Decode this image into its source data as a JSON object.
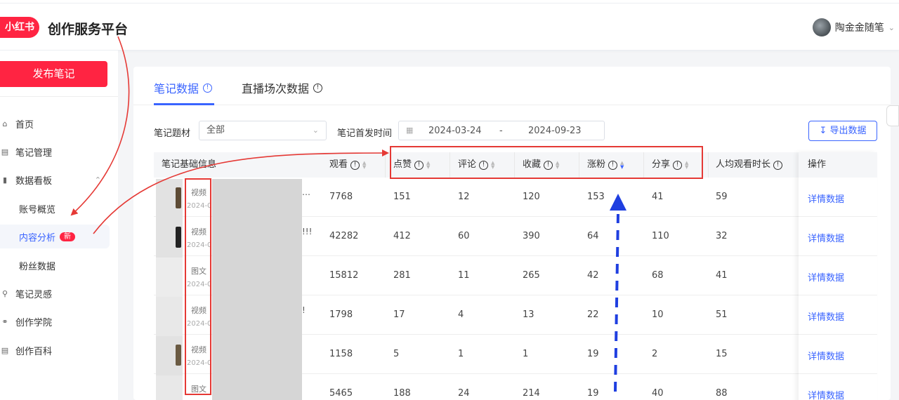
{
  "header": {
    "logo": "小红书",
    "title": "创作服务平台",
    "user_name": "陶金金随笔"
  },
  "sidebar": {
    "publish_label": "发布笔记",
    "items": [
      {
        "label": "首页",
        "icon": "home-icon"
      },
      {
        "label": "笔记管理",
        "icon": "note-icon"
      },
      {
        "label": "数据看板",
        "icon": "chart-icon",
        "expanded": true
      },
      {
        "label": "账号概览"
      },
      {
        "label": "内容分析",
        "badge": "新",
        "active": true
      },
      {
        "label": "粉丝数据"
      },
      {
        "label": "笔记灵感",
        "icon": "bulb-icon"
      },
      {
        "label": "创作学院",
        "icon": "planet-icon"
      },
      {
        "label": "创作百科",
        "icon": "book-icon"
      }
    ]
  },
  "tabs": [
    {
      "label": "笔记数据",
      "active": true
    },
    {
      "label": "直播场次数据",
      "active": false
    }
  ],
  "filters": {
    "topic_label": "笔记题材",
    "topic_value": "全部",
    "date_label": "笔记首发时间",
    "date_start": "2024-03-24",
    "date_sep": "-",
    "date_end": "2024-09-23"
  },
  "export_label": "导出数据",
  "table": {
    "columns": [
      "笔记基础信息",
      "观看",
      "点赞",
      "评论",
      "收藏",
      "涨粉",
      "分享",
      "人均观看时长",
      "操作"
    ],
    "rows": [
      {
        "type": "视频",
        "date": "2024-0",
        "title_frag": "…",
        "views": "7768",
        "likes": "151",
        "comments": "12",
        "favorites": "120",
        "followers": "153",
        "shares": "41",
        "avg_time": "59",
        "action": "详情数据"
      },
      {
        "type": "视频",
        "date": "2024-0",
        "title_frag": "!!!",
        "views": "42282",
        "likes": "412",
        "comments": "60",
        "favorites": "390",
        "followers": "64",
        "shares": "110",
        "avg_time": "32",
        "action": "详情数据"
      },
      {
        "type": "图文",
        "date": "2024-0",
        "title_frag": "",
        "views": "15812",
        "likes": "281",
        "comments": "11",
        "favorites": "265",
        "followers": "42",
        "shares": "68",
        "avg_time": "41",
        "action": "详情数据"
      },
      {
        "type": "视频",
        "date": "2024-0",
        "title_frag": "!",
        "views": "1798",
        "likes": "17",
        "comments": "4",
        "favorites": "13",
        "followers": "22",
        "shares": "10",
        "avg_time": "51",
        "action": "详情数据"
      },
      {
        "type": "视频",
        "date": "2024-0",
        "title_frag": "",
        "views": "1158",
        "likes": "5",
        "comments": "1",
        "favorites": "1",
        "followers": "19",
        "shares": "2",
        "avg_time": "15",
        "action": "详情数据"
      },
      {
        "type": "图文",
        "date": "",
        "title_frag": "",
        "views": "5465",
        "likes": "188",
        "comments": "24",
        "favorites": "214",
        "followers": "19",
        "shares": "40",
        "avg_time": "88",
        "action": "详情数据"
      }
    ]
  },
  "colors": {
    "brand": "#ff2442",
    "accent": "#3a64ff",
    "annotation_red": "#e53935",
    "annotation_blue": "#1f3fe0"
  }
}
